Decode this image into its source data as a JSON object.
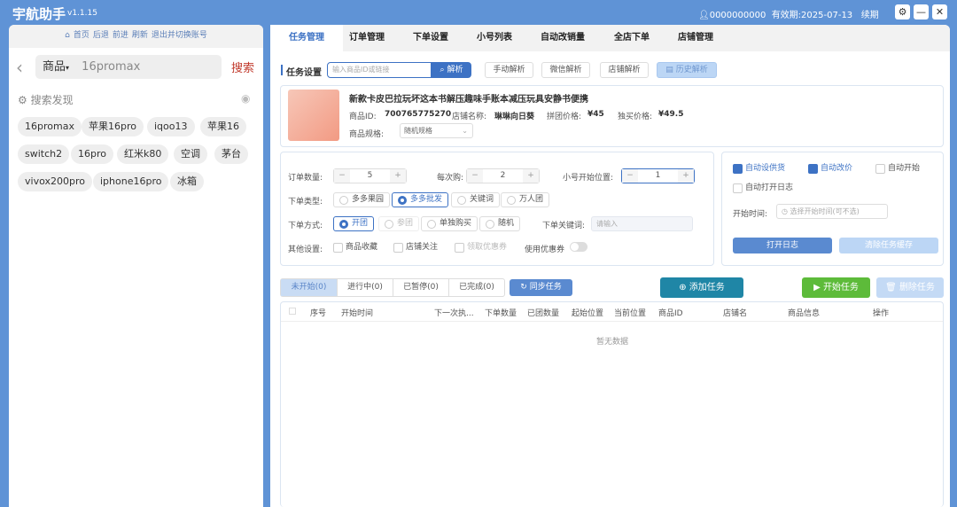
{
  "app": {
    "title": "宇航助手",
    "version": "v1.1.15",
    "user": "0000000000",
    "expiry": "有效期:2025-07-13",
    "renew": "续期"
  },
  "left": {
    "nav": [
      "首页",
      "后退",
      "前进",
      "刷新",
      "退出并切换账号"
    ],
    "search_type": "商品",
    "search_value": "16promax",
    "search_button": "搜索",
    "discover_title": "搜索发现",
    "tags": [
      "16promax",
      "苹果16pro",
      "iqoo13",
      "苹果16",
      "switch2",
      "16pro",
      "红米k80",
      "空调",
      "茅台",
      "vivox200pro",
      "iphone16pro",
      "冰箱"
    ]
  },
  "tabs": [
    "任务管理",
    "订单管理",
    "下单设置",
    "小号列表",
    "自动改销量",
    "全店下单",
    "店铺管理"
  ],
  "task": {
    "section": "任务设置",
    "input_placeholder": "输入商品ID或链接",
    "parse": "解析",
    "manual": "手动解析",
    "wechat": "微信解析",
    "shop": "店铺解析",
    "history": "历史解析"
  },
  "product": {
    "title": "新款卡皮巴拉玩坏这本书解压趣味手账本减压玩具安静书便携",
    "id_label": "商品ID:",
    "id": "700765775270",
    "shop_label": "店铺名称:",
    "shop": "琳琳向日葵",
    "group_label": "拼团价格:",
    "group_price": "¥45",
    "single_label": "独买价格:",
    "single_price": "¥49.5",
    "spec_label": "商品规格:",
    "spec": "随机规格"
  },
  "settings": {
    "order_qty_label": "订单数量:",
    "order_qty": "5",
    "per_buy_label": "每次购:",
    "per_buy": "2",
    "start_pos_label": "小号开始位置:",
    "start_pos": "1",
    "type_label": "下单类型:",
    "types": [
      "多多果园",
      "多多批发",
      "关键词",
      "万人团"
    ],
    "method_label": "下单方式:",
    "methods": [
      "开团",
      "参团",
      "单独购买",
      "随机"
    ],
    "keyword_label": "下单关键词:",
    "keyword_placeholder": "请输入",
    "other_label": "其他设置:",
    "others": [
      "商品收藏",
      "店铺关注",
      "领取优惠券"
    ],
    "coupon_label": "使用优惠券"
  },
  "auto": {
    "checks": [
      "自动设供货",
      "自动改价",
      "自动开始",
      "自动打开日志"
    ],
    "start_label": "开始时间:",
    "start_placeholder": "选择开始时间(可不选)",
    "open_log": "打开日志",
    "clear_cache": "清除任务缓存"
  },
  "list": {
    "filters": [
      "未开始(0)",
      "进行中(0)",
      "已暂停(0)",
      "已完成(0)"
    ],
    "sync": "同步任务",
    "add": "添加任务",
    "start": "开始任务",
    "delete": "删除任务",
    "columns": [
      "序号",
      "开始时间",
      "下一次执...",
      "下单数量",
      "已团数量",
      "起始位置",
      "当前位置",
      "商品ID",
      "店铺名",
      "商品信息",
      "操作"
    ],
    "empty": "暂无数据"
  },
  "colors": {
    "primary": "#3d72c4",
    "add": "#1f86a6",
    "start": "#5dbb3a"
  }
}
